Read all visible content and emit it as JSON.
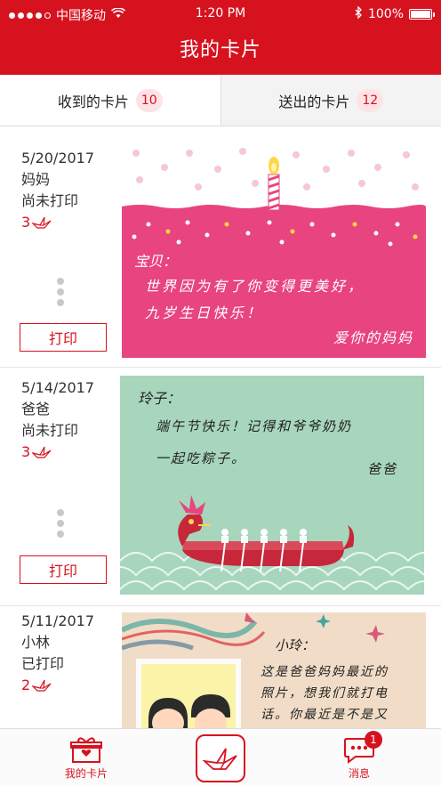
{
  "status_bar": {
    "carrier": "中国移动",
    "time": "1:20 PM",
    "battery": "100%"
  },
  "header": {
    "title": "我的卡片"
  },
  "tabs": [
    {
      "label": "收到的卡片",
      "count": "10"
    },
    {
      "label": "送出的卡片",
      "count": "12"
    }
  ],
  "cards": [
    {
      "date": "5/20/2017",
      "sender": "妈妈",
      "status": "尚未打印",
      "crane_count": "3",
      "print_label": "打印",
      "greeting": "宝贝：",
      "lines": [
        "世界因为有了你变得更美好，",
        "九岁生日快乐！"
      ],
      "signature": "爱你的妈妈"
    },
    {
      "date": "5/14/2017",
      "sender": "爸爸",
      "status": "尚未打印",
      "crane_count": "3",
      "print_label": "打印",
      "greeting": "玲子：",
      "lines": [
        "端午节快乐！记得和爷爷奶奶",
        "一起吃粽子。"
      ],
      "signature": "爸爸"
    },
    {
      "date": "5/11/2017",
      "sender": "小林",
      "status": "已打印",
      "crane_count": "2",
      "greeting": "小玲：",
      "lines": [
        "这是爸爸妈妈最近的",
        "照片，想我们就打电",
        "话。你最近是不是又"
      ]
    }
  ],
  "tabbar": {
    "left_label": "我的卡片",
    "right_label": "消息",
    "message_badge": "1"
  },
  "colors": {
    "brand_red": "#d7121f",
    "birthday_pink": "#e8447f",
    "dragon_green": "#a7d6bd",
    "photo_beige": "#f1ddc7"
  },
  "icons": [
    "signal-dots-icon",
    "wifi-icon",
    "bluetooth-icon",
    "battery-icon",
    "paper-crane-icon",
    "gift-icon",
    "chat-bubble-icon",
    "more-dots-icon"
  ]
}
